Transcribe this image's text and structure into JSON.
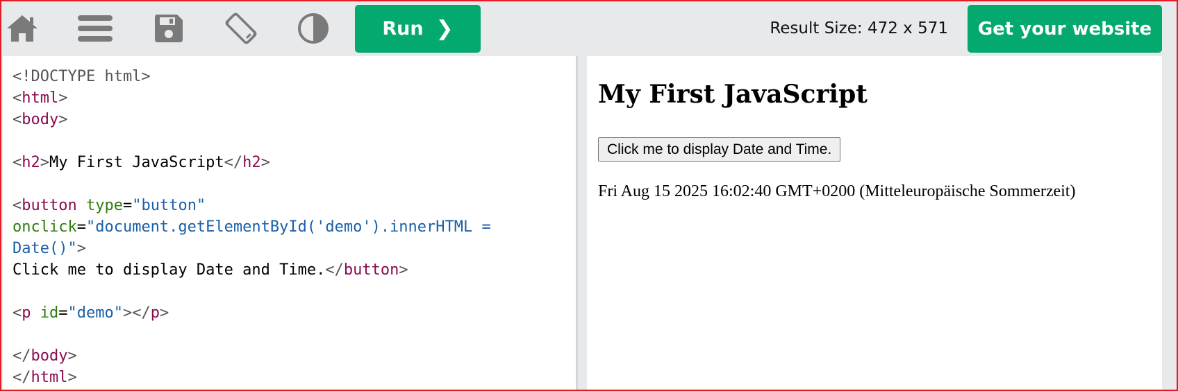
{
  "toolbar": {
    "icons": [
      {
        "name": "home-icon"
      },
      {
        "name": "menu-icon"
      },
      {
        "name": "save-icon"
      },
      {
        "name": "rotate-icon"
      },
      {
        "name": "contrast-icon"
      }
    ],
    "run_label": "Run",
    "run_chevron": "❯",
    "result_size": "Result Size: 472 x 571",
    "website_label": "Get your website"
  },
  "editor": {
    "lines": [
      [
        {
          "t": "doc",
          "s": "<!DOCTYPE html>"
        }
      ],
      [
        {
          "t": "br",
          "s": "<"
        },
        {
          "t": "tag",
          "s": "html"
        },
        {
          "t": "br",
          "s": ">"
        }
      ],
      [
        {
          "t": "br",
          "s": "<"
        },
        {
          "t": "tag",
          "s": "body"
        },
        {
          "t": "br",
          "s": ">"
        }
      ],
      [],
      [
        {
          "t": "br",
          "s": "<"
        },
        {
          "t": "tag",
          "s": "h2"
        },
        {
          "t": "br",
          "s": ">"
        },
        {
          "t": "txt",
          "s": "My First JavaScript"
        },
        {
          "t": "br",
          "s": "</"
        },
        {
          "t": "tag",
          "s": "h2"
        },
        {
          "t": "br",
          "s": ">"
        }
      ],
      [],
      [
        {
          "t": "br",
          "s": "<"
        },
        {
          "t": "tag",
          "s": "button"
        },
        {
          "t": "txt",
          "s": " "
        },
        {
          "t": "attr",
          "s": "type"
        },
        {
          "t": "txt",
          "s": "="
        },
        {
          "t": "val",
          "s": "\"button\""
        }
      ],
      [
        {
          "t": "attr",
          "s": "onclick"
        },
        {
          "t": "txt",
          "s": "="
        },
        {
          "t": "val",
          "s": "\"document.getElementById('demo').innerHTML ="
        }
      ],
      [
        {
          "t": "val",
          "s": "Date()\""
        },
        {
          "t": "br",
          "s": ">"
        }
      ],
      [
        {
          "t": "txt",
          "s": "Click me to display Date and Time."
        },
        {
          "t": "br",
          "s": "</"
        },
        {
          "t": "tag",
          "s": "button"
        },
        {
          "t": "br",
          "s": ">"
        }
      ],
      [],
      [
        {
          "t": "br",
          "s": "<"
        },
        {
          "t": "tag",
          "s": "p"
        },
        {
          "t": "txt",
          "s": " "
        },
        {
          "t": "attr",
          "s": "id"
        },
        {
          "t": "txt",
          "s": "="
        },
        {
          "t": "val",
          "s": "\"demo\""
        },
        {
          "t": "br",
          "s": "></"
        },
        {
          "t": "tag",
          "s": "p"
        },
        {
          "t": "br",
          "s": ">"
        }
      ],
      [],
      [
        {
          "t": "br",
          "s": "</"
        },
        {
          "t": "tag",
          "s": "body"
        },
        {
          "t": "br",
          "s": ">"
        }
      ],
      [
        {
          "t": "br",
          "s": "</"
        },
        {
          "t": "tag",
          "s": "html"
        },
        {
          "t": "br",
          "s": ">"
        }
      ]
    ]
  },
  "result": {
    "heading": "My First JavaScript",
    "button_label": "Click me to display Date and Time.",
    "output": "Fri Aug 15 2025 16:02:40 GMT+0200 (Mitteleuropäische Sommerzeit)"
  },
  "colors": {
    "accent": "#04aa6d",
    "toolbar_bg": "#e7e9eb",
    "icon": "#7a7a7a",
    "tag": "#8b0a50",
    "attr": "#2e7d0b",
    "value": "#1a5fa8",
    "frame": "#e31b23"
  }
}
